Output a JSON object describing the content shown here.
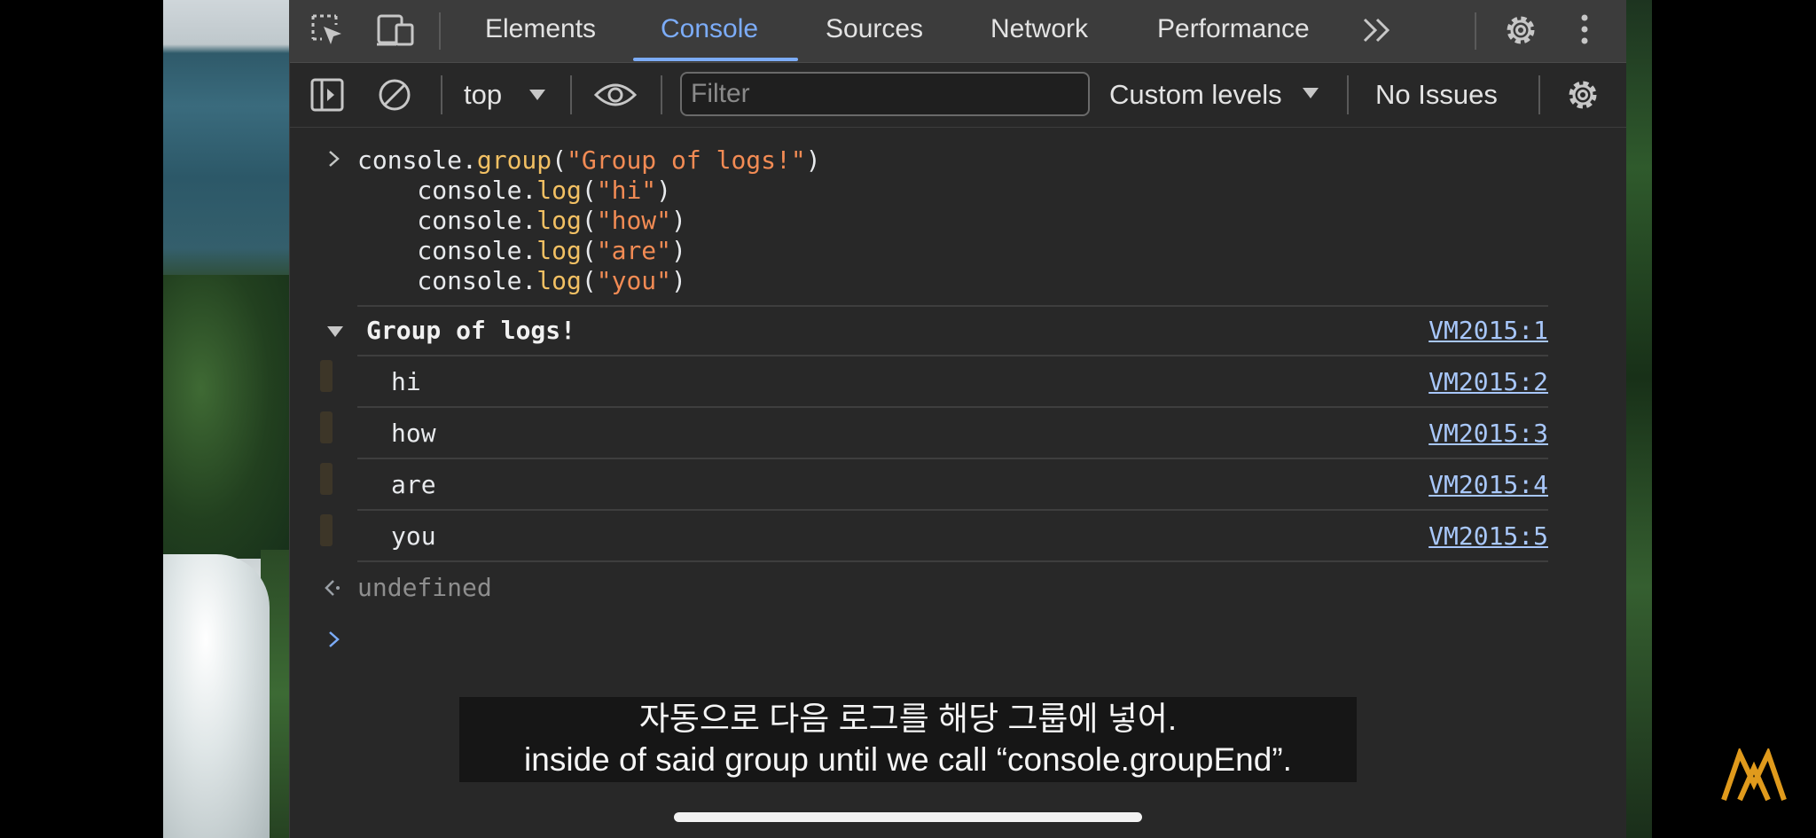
{
  "tabs": [
    {
      "label": "Elements"
    },
    {
      "label": "Console",
      "active": true
    },
    {
      "label": "Sources"
    },
    {
      "label": "Network"
    },
    {
      "label": "Performance"
    }
  ],
  "toolbar": {
    "context": "top",
    "filter_placeholder": "Filter",
    "levels": "Custom levels",
    "issues": "No Issues"
  },
  "console": {
    "input_lines": [
      {
        "obj": "console.",
        "fn": "group",
        "open": "(",
        "arg": "\"Group of logs!\"",
        "close": ")"
      },
      {
        "obj": "    console.",
        "fn": "log",
        "open": "(",
        "arg": "\"hi\"",
        "close": ")"
      },
      {
        "obj": "    console.",
        "fn": "log",
        "open": "(",
        "arg": "\"how\"",
        "close": ")"
      },
      {
        "obj": "    console.",
        "fn": "log",
        "open": "(",
        "arg": "\"are\"",
        "close": ")"
      },
      {
        "obj": "    console.",
        "fn": "log",
        "open": "(",
        "arg": "\"you\"",
        "close": ")"
      }
    ],
    "group": {
      "title": "Group of logs!",
      "source": "VM2015:1"
    },
    "logs": [
      {
        "text": "hi",
        "source": "VM2015:2"
      },
      {
        "text": "how",
        "source": "VM2015:3"
      },
      {
        "text": "are",
        "source": "VM2015:4"
      },
      {
        "text": "you",
        "source": "VM2015:5"
      }
    ],
    "result": "undefined"
  },
  "subtitle": {
    "korean": "자동으로 다음 로그를 해당 그룹에 넣어.",
    "english": "inside of said group until we call “console.groupEnd”."
  },
  "colors": {
    "accent": "#7cacf8",
    "link": "#a8c7fa",
    "function": "#f2c063",
    "string": "#f28b54",
    "logo": "#e09a1c"
  }
}
